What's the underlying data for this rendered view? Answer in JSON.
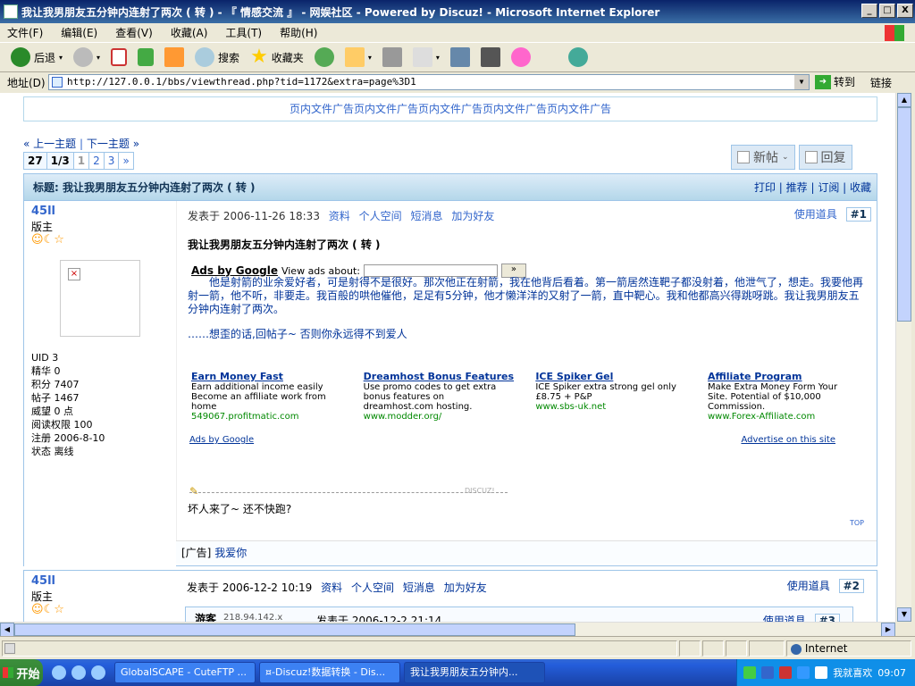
{
  "window": {
    "title": "我让我男朋友五分钟内连射了两次 ( 转 ) - 『 情感交流 』 - 网娱社区 - Powered by Discuz! - Microsoft Internet Explorer",
    "btn_min": "_",
    "btn_max": "□",
    "btn_close": "X"
  },
  "menu": [
    "文件(F)",
    "编辑(E)",
    "查看(V)",
    "收藏(A)",
    "工具(T)",
    "帮助(H)"
  ],
  "toolbar": {
    "back": "后退",
    "search": "搜索",
    "favorites": "收藏夹"
  },
  "address": {
    "label": "地址(D)",
    "url": "http://127.0.0.1/bbs/viewthread.php?tid=1172&extra=page%3D1",
    "go": "转到",
    "links": "链接"
  },
  "page": {
    "top_ad": "页内文件广告页内文件广告页内文件广告页内文件广告页内文件广告",
    "nav_prev": "« 上一主题",
    "nav_sep": "|",
    "nav_next": "下一主题 »",
    "pager": {
      "count": "27",
      "pages": "1/3",
      "current": "1",
      "p2": "2",
      "p3": "3",
      "next": "»"
    },
    "btn_new": "新帖",
    "btn_reply": "回复",
    "subject": "标题: 我让我男朋友五分钟内连射了两次 ( 转 )",
    "thread_links": "打印 | 推荐 | 订阅 | 收藏"
  },
  "post1": {
    "author": "45ll",
    "rank": "版主",
    "stars": "☺☾☆",
    "info": {
      "uid": "UID 3",
      "essence": "精华 0",
      "credits": "积分 7407",
      "posts": "帖子 1467",
      "prestige": "威望 0 点",
      "readperm": "阅读权限 100",
      "regdate": "注册 2006-8-10",
      "status": "状态 离线"
    },
    "date": "发表于 2006-11-26 18:33",
    "profile": "资料",
    "space": "个人空间",
    "pm": "短消息",
    "addfriend": "加为好友",
    "tools": "使用道具",
    "floor": "#1",
    "title": "我让我男朋友五分钟内连射了两次 ( 转 )",
    "ads_search_label": "Ads by Google",
    "ads_search_about": "View ads about:",
    "ads_search_btn": "»",
    "body": "他是射箭的业余爱好者，可是射得不是很好。那次他正在射箭，我在他背后看着。第一箭居然连靶子都没射着，他泄气了，想走。我要他再射一箭，他不听，非要走。我百般的哄他催他，足足有5分钟，他才懒洋洋的又射了一箭，直中靶心。我和他都高兴得跳呀跳。我让我男朋友五分钟内连射了两次。",
    "sig": "……想歪的话,回帖子~ 否则你永远得不到爱人",
    "ads": [
      {
        "title": "Earn Money Fast",
        "desc": "Earn additional income easily Become an affiliate work from home",
        "url": "549067.profitmatic.com"
      },
      {
        "title": "Dreamhost Bonus Features",
        "desc": "Use promo codes to get extra bonus features on dreamhost.com hosting.",
        "url": "www.modder.org/"
      },
      {
        "title": "ICE Spiker Gel",
        "desc": "ICE Spiker extra strong gel only £8.75 + P&P",
        "url": "www.sbs-uk.net"
      },
      {
        "title": "Affiliate Program",
        "desc": "Make Extra Money Form Your Site. Potential of $10,000 Commission.",
        "url": "www.Forex-Affiliate.com"
      }
    ],
    "ads_by": "Ads by Google",
    "advertise": "Advertise on this site",
    "discuz_mark": "DISCUZ!",
    "signature": "坏人来了~ 还不快跑?",
    "top": "TOP",
    "adline_label": "[广告]",
    "adline_link": "我爱你"
  },
  "post2": {
    "author": "45ll",
    "rank": "版主",
    "stars": "☺☾☆",
    "date": "发表于 2006-12-2 10:19",
    "profile": "资料",
    "space": "个人空间",
    "pm": "短消息",
    "addfriend": "加为好友",
    "tools": "使用道具",
    "floor": "#2"
  },
  "post3": {
    "guest": "游客",
    "ip": "218.94.142.x",
    "date": "发表于 2006-12-2 21:14",
    "tools": "使用道具",
    "floor": "#3"
  },
  "status": {
    "zone": "Internet"
  },
  "taskbar": {
    "start": "开始",
    "tasks": [
      "GlobalSCAPE - CuteFTP ...",
      "¤-Discuz!数据转换 - Dis...",
      "我让我男朋友五分钟内..."
    ],
    "tray_text": "我就喜欢",
    "clock": "09:07"
  }
}
